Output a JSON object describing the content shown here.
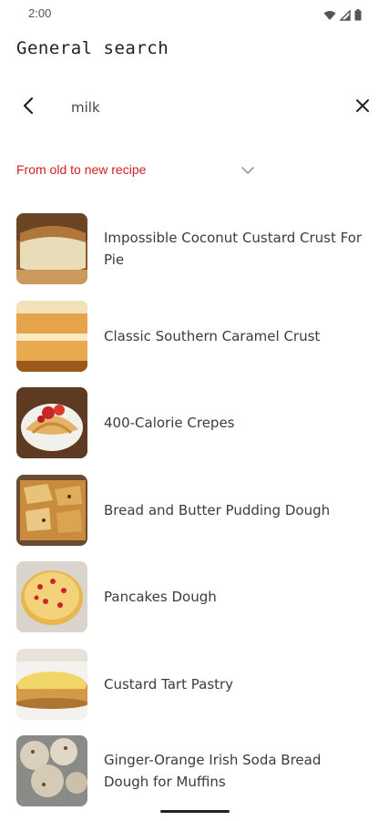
{
  "status_bar": {
    "time": "2:00",
    "icons": [
      "wifi-icon",
      "signal-icon",
      "battery-icon"
    ]
  },
  "header": {
    "title": "General search"
  },
  "search": {
    "value": "milk",
    "back_icon": "chevron-left-icon",
    "clear_icon": "close-icon"
  },
  "sort": {
    "label": "From old to new recipe",
    "icon": "chevron-down-icon"
  },
  "recipes": [
    {
      "title": "Impossible Coconut Custard Crust For Pie"
    },
    {
      "title": "Classic Southern Caramel Crust"
    },
    {
      "title": "400-Calorie Crepes"
    },
    {
      "title": "Bread and Butter Pudding Dough"
    },
    {
      "title": "Pancakes Dough"
    },
    {
      "title": "Custard Tart Pastry"
    },
    {
      "title": "Ginger-Orange Irish Soda Bread Dough for Muffins"
    }
  ],
  "colors": {
    "accent": "#d41f26",
    "text": "#3c3c3c"
  }
}
